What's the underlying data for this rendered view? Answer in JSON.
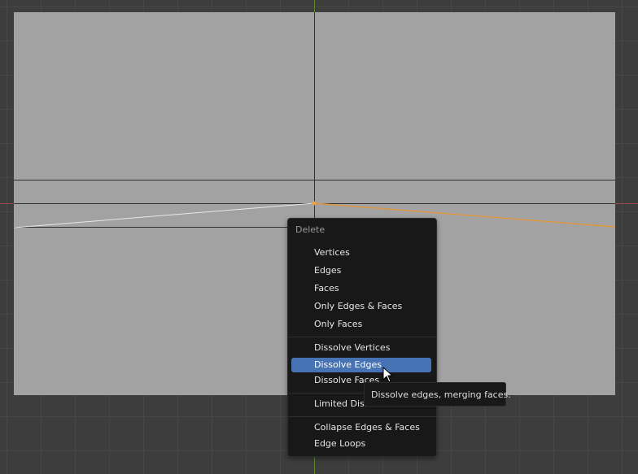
{
  "menu": {
    "title": "Delete",
    "groups": [
      [
        {
          "label": "Vertices"
        },
        {
          "label": "Edges"
        },
        {
          "label": "Faces"
        },
        {
          "label": "Only Edges & Faces"
        },
        {
          "label": "Only Faces"
        }
      ],
      [
        {
          "label": "Dissolve Vertices"
        },
        {
          "label": "Dissolve Edges",
          "highlighted": true
        },
        {
          "label": "Dissolve Faces"
        }
      ],
      [
        {
          "label": "Limited Dissolve"
        }
      ],
      [
        {
          "label": "Collapse Edges & Faces"
        },
        {
          "label": "Edge Loops"
        }
      ]
    ]
  },
  "tooltip": {
    "text": "Dissolve edges, merging faces."
  },
  "icons": {
    "cursor": "arrow-cursor-icon"
  },
  "colors": {
    "menu_highlight": "#4772b3",
    "selected_edge": "#e0953a",
    "x_axis": "#9b4a4f",
    "y_axis": "#5f8a2f",
    "mesh_face": "#a2a2a3"
  }
}
